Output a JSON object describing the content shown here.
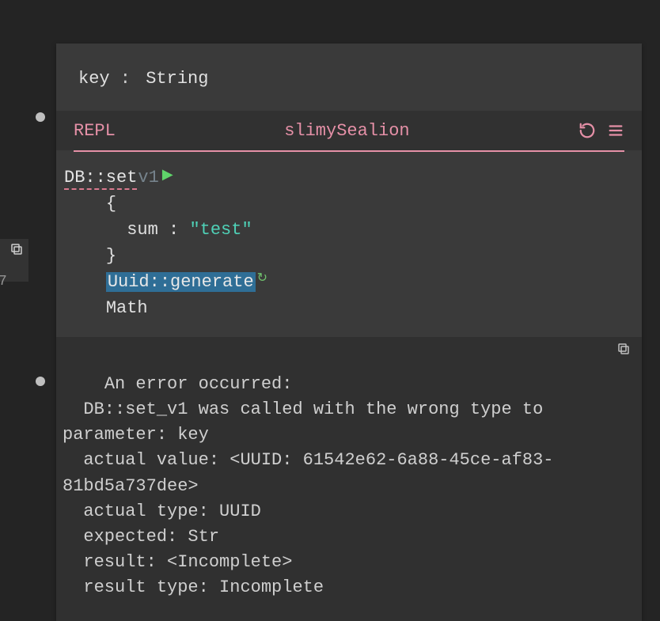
{
  "signature": {
    "param": "key",
    "sep": " : ",
    "type": "String"
  },
  "repl": {
    "label": "REPL",
    "name": "slimySealion"
  },
  "code": {
    "fn": "DB::set",
    "version": "v1",
    "indent": "    ",
    "brace_open": "{",
    "brace_close": "}",
    "record_line": "  sum : ",
    "record_value": "\"test\"",
    "selected_fn": "Uuid::generate",
    "last_line": "Math"
  },
  "error": {
    "l1": "An error occurred:",
    "l2": "  DB::set_v1 was called with the wrong type to parameter: key",
    "l3": "  actual value: <UUID: 61542e62-6a88-45ce-af83-81bd5a737dee>",
    "l4": "  actual type: UUID",
    "l5": "  expected: Str",
    "l6": "  result: <Incomplete>",
    "l7": "  result type: Incomplete"
  }
}
